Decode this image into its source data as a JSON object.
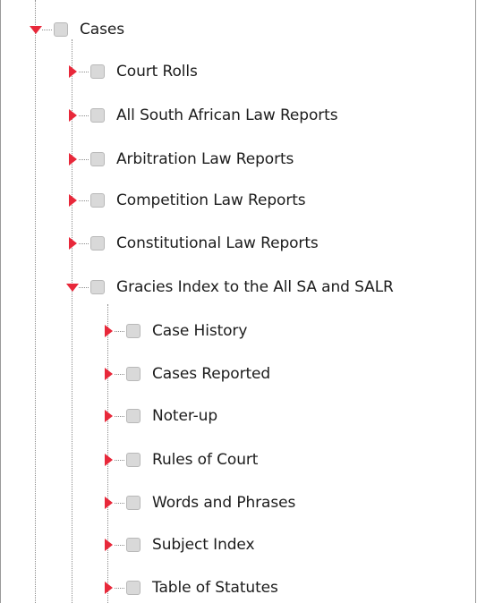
{
  "tree": {
    "root": {
      "label": "Cases",
      "expanded": true,
      "checked": false
    },
    "children": [
      {
        "label": "Court Rolls",
        "expanded": false,
        "checked": false
      },
      {
        "label": "All South African Law Reports",
        "expanded": false,
        "checked": false
      },
      {
        "label": "Arbitration Law Reports",
        "expanded": false,
        "checked": false
      },
      {
        "label": "Competition Law Reports",
        "expanded": false,
        "checked": false
      },
      {
        "label": "Constitutional Law Reports",
        "expanded": false,
        "checked": false
      },
      {
        "label": "Gracies Index to the All SA and SALR",
        "expanded": true,
        "checked": false,
        "children": [
          {
            "label": "Case History",
            "expanded": false,
            "checked": false
          },
          {
            "label": "Cases Reported",
            "expanded": false,
            "checked": false
          },
          {
            "label": "Noter-up",
            "expanded": false,
            "checked": false
          },
          {
            "label": "Rules of Court",
            "expanded": false,
            "checked": false
          },
          {
            "label": "Words and Phrases",
            "expanded": false,
            "checked": false
          },
          {
            "label": "Subject Index",
            "expanded": false,
            "checked": false
          },
          {
            "label": "Table of Statutes",
            "expanded": false,
            "checked": false
          }
        ]
      }
    ]
  },
  "colors": {
    "toggle_arrow": "#e8283a",
    "checkbox_fill": "#d9d9d9",
    "checkbox_border": "#b8b8b8",
    "tree_line": "#8c8c8c",
    "text": "#1c1c1c",
    "frame": "#9a9a9a"
  }
}
